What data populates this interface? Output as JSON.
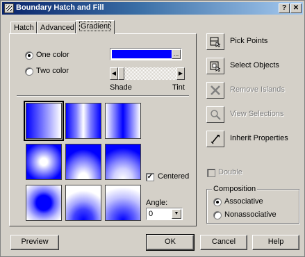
{
  "window": {
    "title": "Boundary Hatch and Fill",
    "help_btn": "?",
    "close_btn": "✕"
  },
  "tabs": [
    {
      "label": "Hatch",
      "active": false
    },
    {
      "label": "Advanced",
      "active": false
    },
    {
      "label": "Gradient",
      "active": true
    }
  ],
  "gradient": {
    "one_color": {
      "label": "One color",
      "checked": true
    },
    "two_color": {
      "label": "Two color",
      "checked": false
    },
    "color_value": "#0000ff",
    "browse_label": "...",
    "shade_label": "Shade",
    "tint_label": "Tint",
    "slider_level": 0.0,
    "centered_label": "Centered",
    "centered_checked": true,
    "angle_label": "Angle:",
    "angle_value": "0",
    "selected_pattern": 0
  },
  "actions": [
    {
      "label": "Pick Points",
      "icon": "pick-points-icon",
      "enabled": true
    },
    {
      "label": "Select Objects",
      "icon": "select-objects-icon",
      "enabled": true
    },
    {
      "label": "Remove Islands",
      "icon": "remove-islands-icon",
      "enabled": false
    },
    {
      "label": "View Selections",
      "icon": "view-selections-icon",
      "enabled": false
    },
    {
      "label": "Inherit Properties",
      "icon": "inherit-properties-icon",
      "enabled": true
    }
  ],
  "double": {
    "label": "Double",
    "checked": false,
    "enabled": false
  },
  "composition": {
    "title": "Composition",
    "associative": {
      "label": "Associative",
      "checked": true
    },
    "nonassociative": {
      "label": "Nonassociative",
      "checked": false
    }
  },
  "buttons": {
    "preview": "Preview",
    "ok": "OK",
    "cancel": "Cancel",
    "help": "Help"
  },
  "colors": {
    "accent": "#0000ff",
    "title_start": "#0a246a",
    "face": "#d4d0c8"
  }
}
